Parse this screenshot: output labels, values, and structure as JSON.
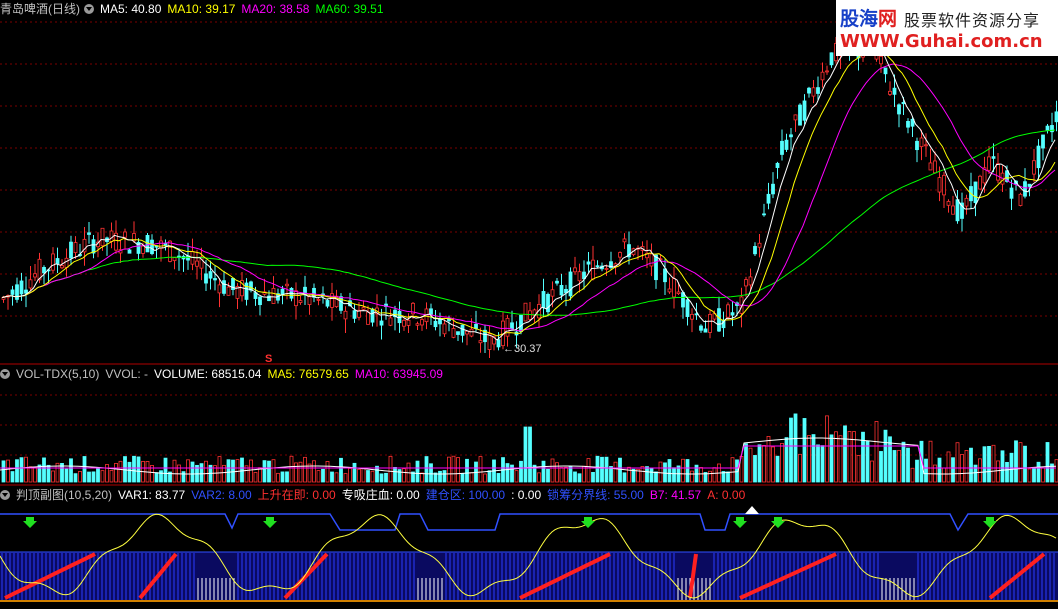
{
  "main": {
    "title": "青岛啤酒(日线)",
    "ma5": "MA5: 40.80",
    "ma10": "MA10: 39.17",
    "ma20": "MA20: 38.58",
    "ma60": "MA60: 39.51",
    "low_label": "30.37",
    "s_marker": "S",
    "colors": {
      "ma5": "#ffffff",
      "ma10": "#ffff00",
      "ma20": "#ff00ff",
      "ma60": "#00ff00"
    }
  },
  "volume": {
    "title": "VOL-TDX(5,10)",
    "vvol": "VVOL: -",
    "volume": "VOLUME: 68515.04",
    "ma5": "MA5: 76579.65",
    "ma10": "MA10: 63945.09"
  },
  "indicator": {
    "title": "判顶副图(10,5,20)",
    "var1": "VAR1: 83.77",
    "var2": "VAR2: 8.00",
    "rise": "上升在即: 0.00",
    "suck": "专吸庄血: 0.00",
    "build": "建仓区: 100.00",
    "colon": ": 0.00",
    "lock": "锁筹分界线: 55.00",
    "b7": "B7: 41.57",
    "a": "A: 0.00"
  },
  "logo": {
    "cn_part1": "股海",
    "cn_part2": "网",
    "slogan": "股票软件资源分享",
    "url": "WWW.Guhai.com.cn"
  },
  "chart_data": {
    "type": "candlestick-with-volume-and-indicator",
    "price_range": [
      29.5,
      48.5
    ],
    "low_annotation": 30.37,
    "indicator_levels": {
      "build_zone": 100,
      "lock_line": 55
    }
  }
}
